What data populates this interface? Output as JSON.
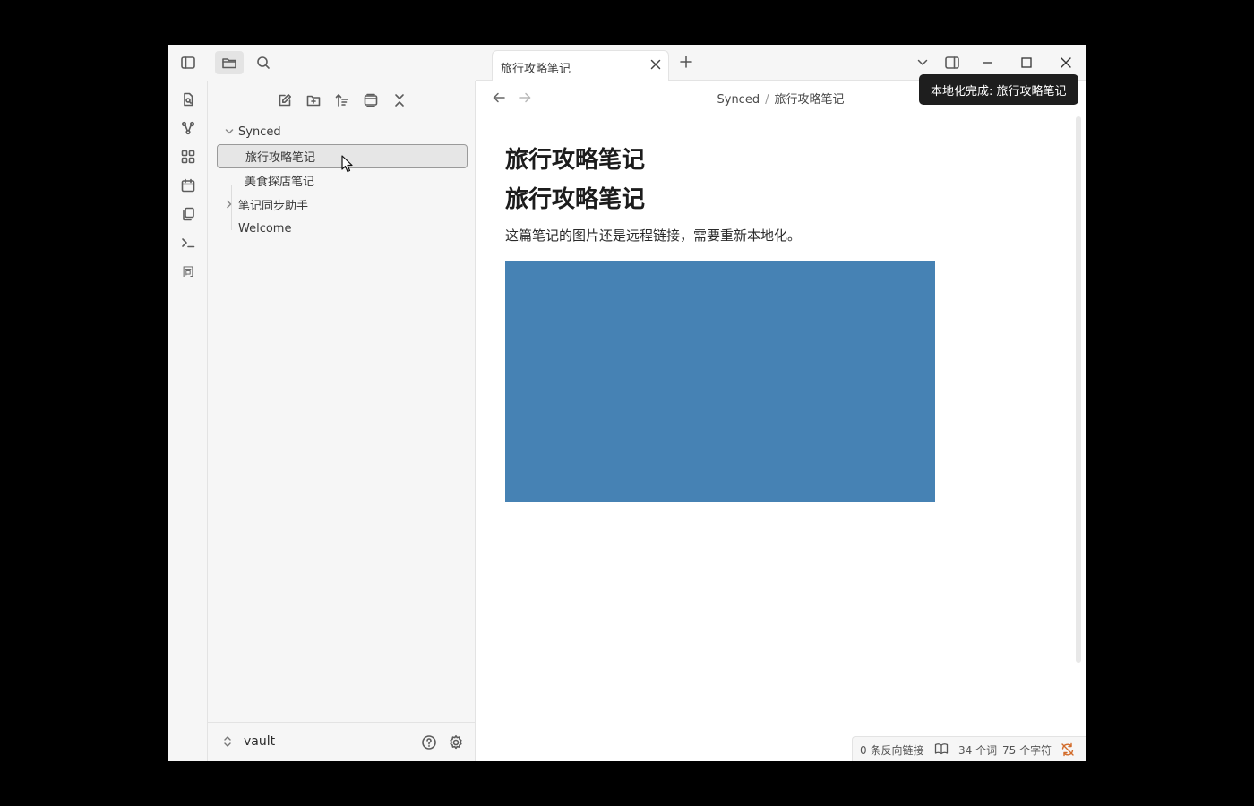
{
  "sidebar": {
    "tree": {
      "folder_synced": "Synced",
      "file_travel": "旅行攻略笔记",
      "file_food": "美食探店笔记",
      "folder_helper": "笔记同步助手",
      "file_welcome": "Welcome"
    },
    "vault_name": "vault"
  },
  "tabs": [
    {
      "label": "旅行攻略笔记",
      "active": true
    }
  ],
  "breadcrumb": {
    "folder": "Synced",
    "separator": "/",
    "file": "旅行攻略笔记"
  },
  "tooltip": "本地化完成: 旅行攻略笔记",
  "document": {
    "heading1": "旅行攻略笔记",
    "heading2": "旅行攻略笔记",
    "paragraph": "这篇笔记的图片还是远程链接，需要重新本地化。",
    "image_color": "#4682b4"
  },
  "statusbar": {
    "backlinks": "0 条反向链接",
    "words": "34 个词",
    "chars": "75 个字符"
  },
  "icons": {
    "ribbon": [
      "quick-switcher-icon",
      "graph-view-icon",
      "canvas-icon",
      "daily-note-icon",
      "templates-icon",
      "command-palette-icon",
      "sync-plugin-icon"
    ],
    "ribbon_plugin_glyph": "同"
  }
}
